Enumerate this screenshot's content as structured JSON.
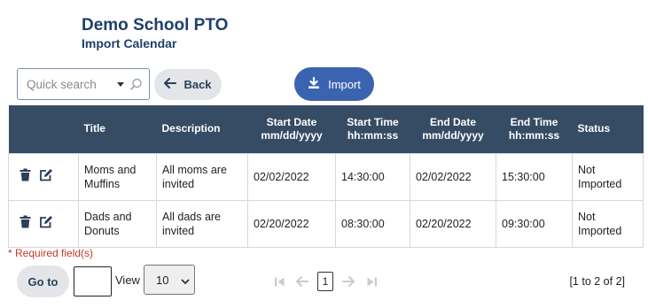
{
  "header": {
    "org_name": "Demo School PTO",
    "page_title": "Import Calendar"
  },
  "toolbar": {
    "search_placeholder": "Quick search",
    "back_label": "Back",
    "import_label": "Import"
  },
  "table": {
    "columns": {
      "title": "Title",
      "description": "Description",
      "start_date": "Start Date",
      "start_date_format": "mm/dd/yyyy",
      "start_time": "Start Time",
      "start_time_format": "hh:mm:ss",
      "end_date": "End Date",
      "end_date_format": "mm/dd/yyyy",
      "end_time": "End Time",
      "end_time_format": "hh:mm:ss",
      "status": "Status"
    },
    "rows": [
      {
        "title_line1": "Moms and",
        "title_line2": "Muffins",
        "description_line1": "All moms are",
        "description_line2": "invited",
        "start_date": "02/02/2022",
        "start_time": "14:30:00",
        "end_date": "02/02/2022",
        "end_time": "15:30:00",
        "status_line1": "Not",
        "status_line2": "Imported"
      },
      {
        "title_line1": "Dads and",
        "title_line2": "Donuts",
        "description_line1": "All dads are",
        "description_line2": "invited",
        "start_date": "02/20/2022",
        "start_time": "08:30:00",
        "end_date": "02/20/2022",
        "end_time": "09:30:00",
        "status_line1": "Not",
        "status_line2": "Imported"
      }
    ]
  },
  "footer": {
    "required_note": "* Required field(s)",
    "goto_label": "Go to",
    "goto_value": "",
    "view_label": "View",
    "page_size": "10",
    "current_page": "1",
    "range_text": "[1 to 2 of 2]"
  },
  "colors": {
    "header_text": "#1f3f6b",
    "table_header_bg": "#364b64",
    "primary_button": "#3a63b0",
    "secondary_button": "#e3e5e8",
    "required_text": "#c0392b"
  }
}
